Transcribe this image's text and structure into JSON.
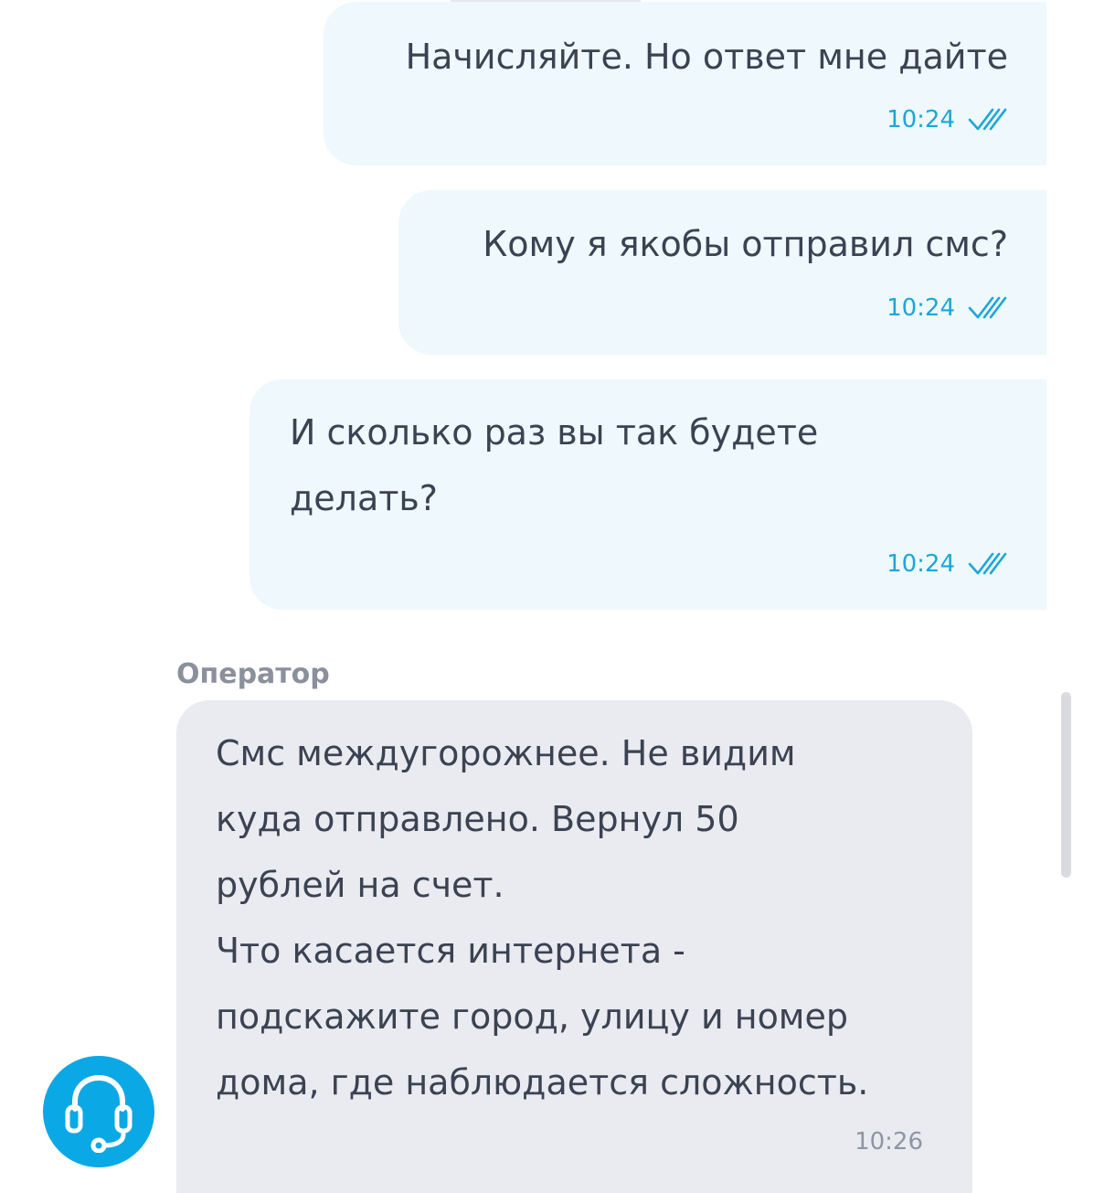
{
  "messages_outgoing": [
    {
      "text": "Начисляйте. Но ответ мне дайте",
      "time": "10:24"
    },
    {
      "text": "Кому я якобы отправил смс?",
      "time": "10:24"
    },
    {
      "text": "И сколько раз вы так будете\nделать?",
      "time": "10:24"
    }
  ],
  "operator": {
    "sender_label": "Оператор",
    "text": "Смс междугорожнее. Не видим\nкуда отправлено. Вернул 50\nрублей на счет.\nЧто касается интернета -\nподскажите город, улицу и номер\nдома, где наблюдается сложность.",
    "time": "10:26"
  },
  "colors": {
    "outgoing_bubble": "#eef8fd",
    "incoming_bubble": "#e9ebf1",
    "accent": "#1ca6d8",
    "support_button": "#0ba8e6"
  },
  "icons": {
    "read_status": "double-check-icon",
    "support": "headset-icon"
  }
}
